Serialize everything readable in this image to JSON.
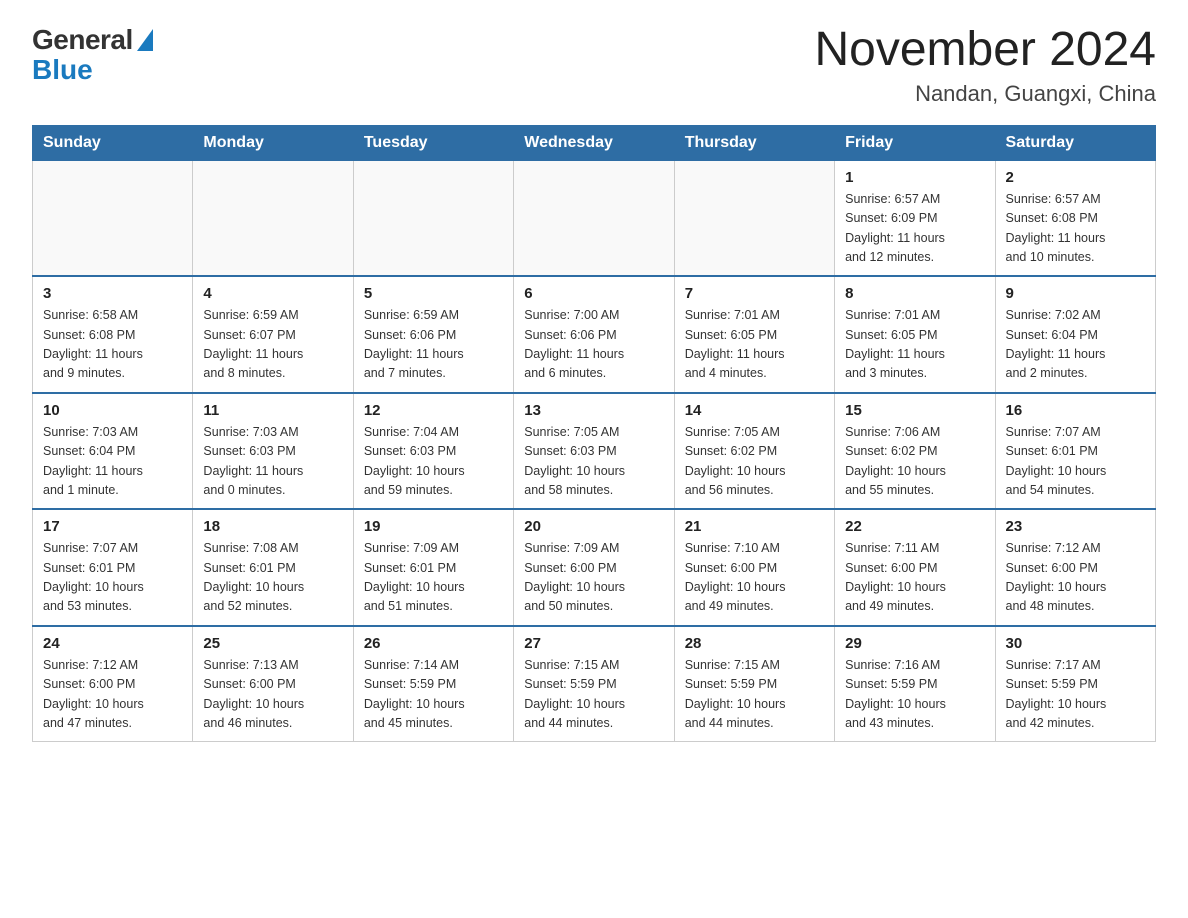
{
  "logo": {
    "general": "General",
    "blue": "Blue"
  },
  "header": {
    "month": "November 2024",
    "location": "Nandan, Guangxi, China"
  },
  "days_of_week": [
    "Sunday",
    "Monday",
    "Tuesday",
    "Wednesday",
    "Thursday",
    "Friday",
    "Saturday"
  ],
  "weeks": [
    [
      {
        "day": "",
        "info": ""
      },
      {
        "day": "",
        "info": ""
      },
      {
        "day": "",
        "info": ""
      },
      {
        "day": "",
        "info": ""
      },
      {
        "day": "",
        "info": ""
      },
      {
        "day": "1",
        "info": "Sunrise: 6:57 AM\nSunset: 6:09 PM\nDaylight: 11 hours\nand 12 minutes."
      },
      {
        "day": "2",
        "info": "Sunrise: 6:57 AM\nSunset: 6:08 PM\nDaylight: 11 hours\nand 10 minutes."
      }
    ],
    [
      {
        "day": "3",
        "info": "Sunrise: 6:58 AM\nSunset: 6:08 PM\nDaylight: 11 hours\nand 9 minutes."
      },
      {
        "day": "4",
        "info": "Sunrise: 6:59 AM\nSunset: 6:07 PM\nDaylight: 11 hours\nand 8 minutes."
      },
      {
        "day": "5",
        "info": "Sunrise: 6:59 AM\nSunset: 6:06 PM\nDaylight: 11 hours\nand 7 minutes."
      },
      {
        "day": "6",
        "info": "Sunrise: 7:00 AM\nSunset: 6:06 PM\nDaylight: 11 hours\nand 6 minutes."
      },
      {
        "day": "7",
        "info": "Sunrise: 7:01 AM\nSunset: 6:05 PM\nDaylight: 11 hours\nand 4 minutes."
      },
      {
        "day": "8",
        "info": "Sunrise: 7:01 AM\nSunset: 6:05 PM\nDaylight: 11 hours\nand 3 minutes."
      },
      {
        "day": "9",
        "info": "Sunrise: 7:02 AM\nSunset: 6:04 PM\nDaylight: 11 hours\nand 2 minutes."
      }
    ],
    [
      {
        "day": "10",
        "info": "Sunrise: 7:03 AM\nSunset: 6:04 PM\nDaylight: 11 hours\nand 1 minute."
      },
      {
        "day": "11",
        "info": "Sunrise: 7:03 AM\nSunset: 6:03 PM\nDaylight: 11 hours\nand 0 minutes."
      },
      {
        "day": "12",
        "info": "Sunrise: 7:04 AM\nSunset: 6:03 PM\nDaylight: 10 hours\nand 59 minutes."
      },
      {
        "day": "13",
        "info": "Sunrise: 7:05 AM\nSunset: 6:03 PM\nDaylight: 10 hours\nand 58 minutes."
      },
      {
        "day": "14",
        "info": "Sunrise: 7:05 AM\nSunset: 6:02 PM\nDaylight: 10 hours\nand 56 minutes."
      },
      {
        "day": "15",
        "info": "Sunrise: 7:06 AM\nSunset: 6:02 PM\nDaylight: 10 hours\nand 55 minutes."
      },
      {
        "day": "16",
        "info": "Sunrise: 7:07 AM\nSunset: 6:01 PM\nDaylight: 10 hours\nand 54 minutes."
      }
    ],
    [
      {
        "day": "17",
        "info": "Sunrise: 7:07 AM\nSunset: 6:01 PM\nDaylight: 10 hours\nand 53 minutes."
      },
      {
        "day": "18",
        "info": "Sunrise: 7:08 AM\nSunset: 6:01 PM\nDaylight: 10 hours\nand 52 minutes."
      },
      {
        "day": "19",
        "info": "Sunrise: 7:09 AM\nSunset: 6:01 PM\nDaylight: 10 hours\nand 51 minutes."
      },
      {
        "day": "20",
        "info": "Sunrise: 7:09 AM\nSunset: 6:00 PM\nDaylight: 10 hours\nand 50 minutes."
      },
      {
        "day": "21",
        "info": "Sunrise: 7:10 AM\nSunset: 6:00 PM\nDaylight: 10 hours\nand 49 minutes."
      },
      {
        "day": "22",
        "info": "Sunrise: 7:11 AM\nSunset: 6:00 PM\nDaylight: 10 hours\nand 49 minutes."
      },
      {
        "day": "23",
        "info": "Sunrise: 7:12 AM\nSunset: 6:00 PM\nDaylight: 10 hours\nand 48 minutes."
      }
    ],
    [
      {
        "day": "24",
        "info": "Sunrise: 7:12 AM\nSunset: 6:00 PM\nDaylight: 10 hours\nand 47 minutes."
      },
      {
        "day": "25",
        "info": "Sunrise: 7:13 AM\nSunset: 6:00 PM\nDaylight: 10 hours\nand 46 minutes."
      },
      {
        "day": "26",
        "info": "Sunrise: 7:14 AM\nSunset: 5:59 PM\nDaylight: 10 hours\nand 45 minutes."
      },
      {
        "day": "27",
        "info": "Sunrise: 7:15 AM\nSunset: 5:59 PM\nDaylight: 10 hours\nand 44 minutes."
      },
      {
        "day": "28",
        "info": "Sunrise: 7:15 AM\nSunset: 5:59 PM\nDaylight: 10 hours\nand 44 minutes."
      },
      {
        "day": "29",
        "info": "Sunrise: 7:16 AM\nSunset: 5:59 PM\nDaylight: 10 hours\nand 43 minutes."
      },
      {
        "day": "30",
        "info": "Sunrise: 7:17 AM\nSunset: 5:59 PM\nDaylight: 10 hours\nand 42 minutes."
      }
    ]
  ]
}
